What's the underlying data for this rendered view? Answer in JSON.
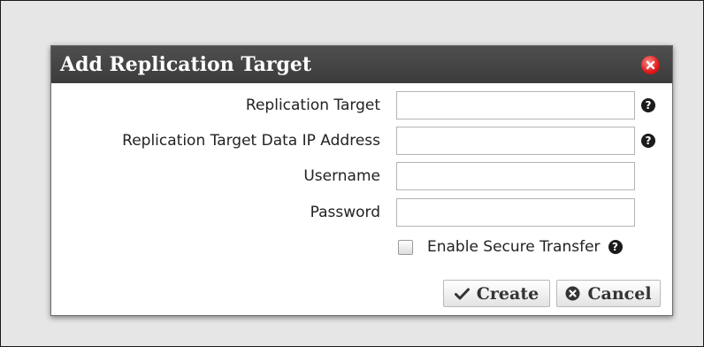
{
  "dialog": {
    "title": "Add Replication Target",
    "fields": [
      {
        "label": "Replication Target",
        "value": "",
        "has_help": true
      },
      {
        "label": "Replication Target Data IP Address",
        "value": "",
        "has_help": true
      },
      {
        "label": "Username",
        "value": "",
        "has_help": false
      },
      {
        "label": "Password",
        "value": "",
        "has_help": false
      }
    ],
    "secure_transfer": {
      "label": "Enable Secure Transfer",
      "checked": false
    },
    "help_glyph": "?",
    "buttons": {
      "create": "Create",
      "cancel": "Cancel"
    }
  },
  "icons": {
    "close": "close-circle-icon",
    "help": "question-circle-icon",
    "create": "checkmark-icon",
    "cancel": "cancel-circle-icon"
  },
  "colors": {
    "titlebar": "#3f3f3f",
    "close": "#e01818",
    "background": "#e6e6e6"
  }
}
